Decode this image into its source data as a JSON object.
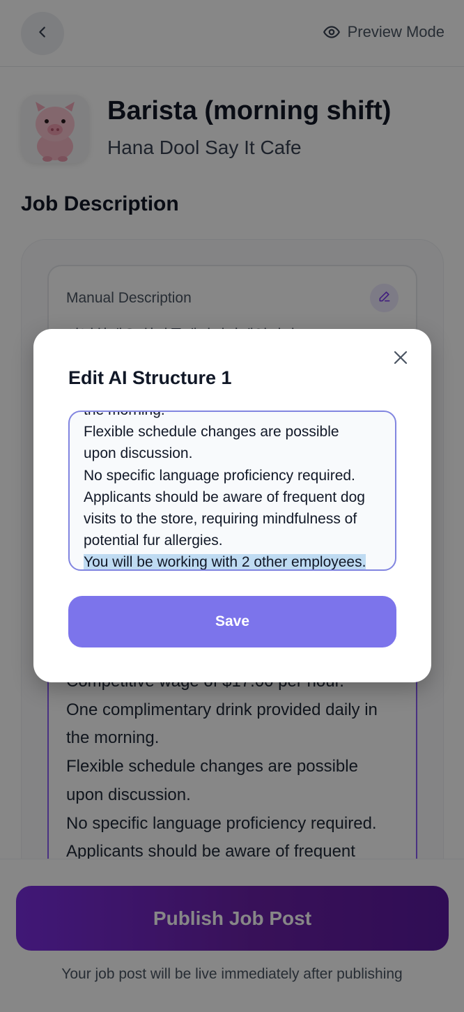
{
  "header": {
    "preview_label": "Preview Mode"
  },
  "job": {
    "title": "Barista (morning shift)",
    "company": "Hana Dool Say It Cafe"
  },
  "section_title": "Job Description",
  "manual": {
    "label": "Manual Description",
    "text_partial": "안녕하세요 하나둘세이잇카페입니다"
  },
  "ai_structure_lines": [
    "Competitive wage of $17.00 per hour.",
    "One complimentary drink provided daily in",
    "the morning.",
    "Flexible schedule changes are possible",
    "upon discussion.",
    "No specific language proficiency required.",
    "Applicants should be aware of frequent"
  ],
  "footer": {
    "publish_label": "Publish Job Post",
    "note": "Your job post will be live immediately after publishing"
  },
  "modal": {
    "title": "Edit AI Structure 1",
    "textarea_lines": [
      "the morning.",
      "Flexible schedule changes are possible",
      "upon discussion.",
      "No specific language proficiency required.",
      "Applicants should be aware of frequent dog",
      "visits to the store, requiring mindfulness of",
      "potential fur allergies.",
      "You will be working with 2 other employees."
    ],
    "selected_line": "You will be working with 2 other employees.",
    "save_label": "Save"
  },
  "icons": {
    "back": "chevron-left-icon",
    "preview": "eye-icon",
    "edit": "pencil-icon",
    "close": "close-icon"
  },
  "colors": {
    "accent_purple": "#7a2ee0",
    "save_button": "#7c74eb",
    "selection": "#bfdbf2"
  }
}
